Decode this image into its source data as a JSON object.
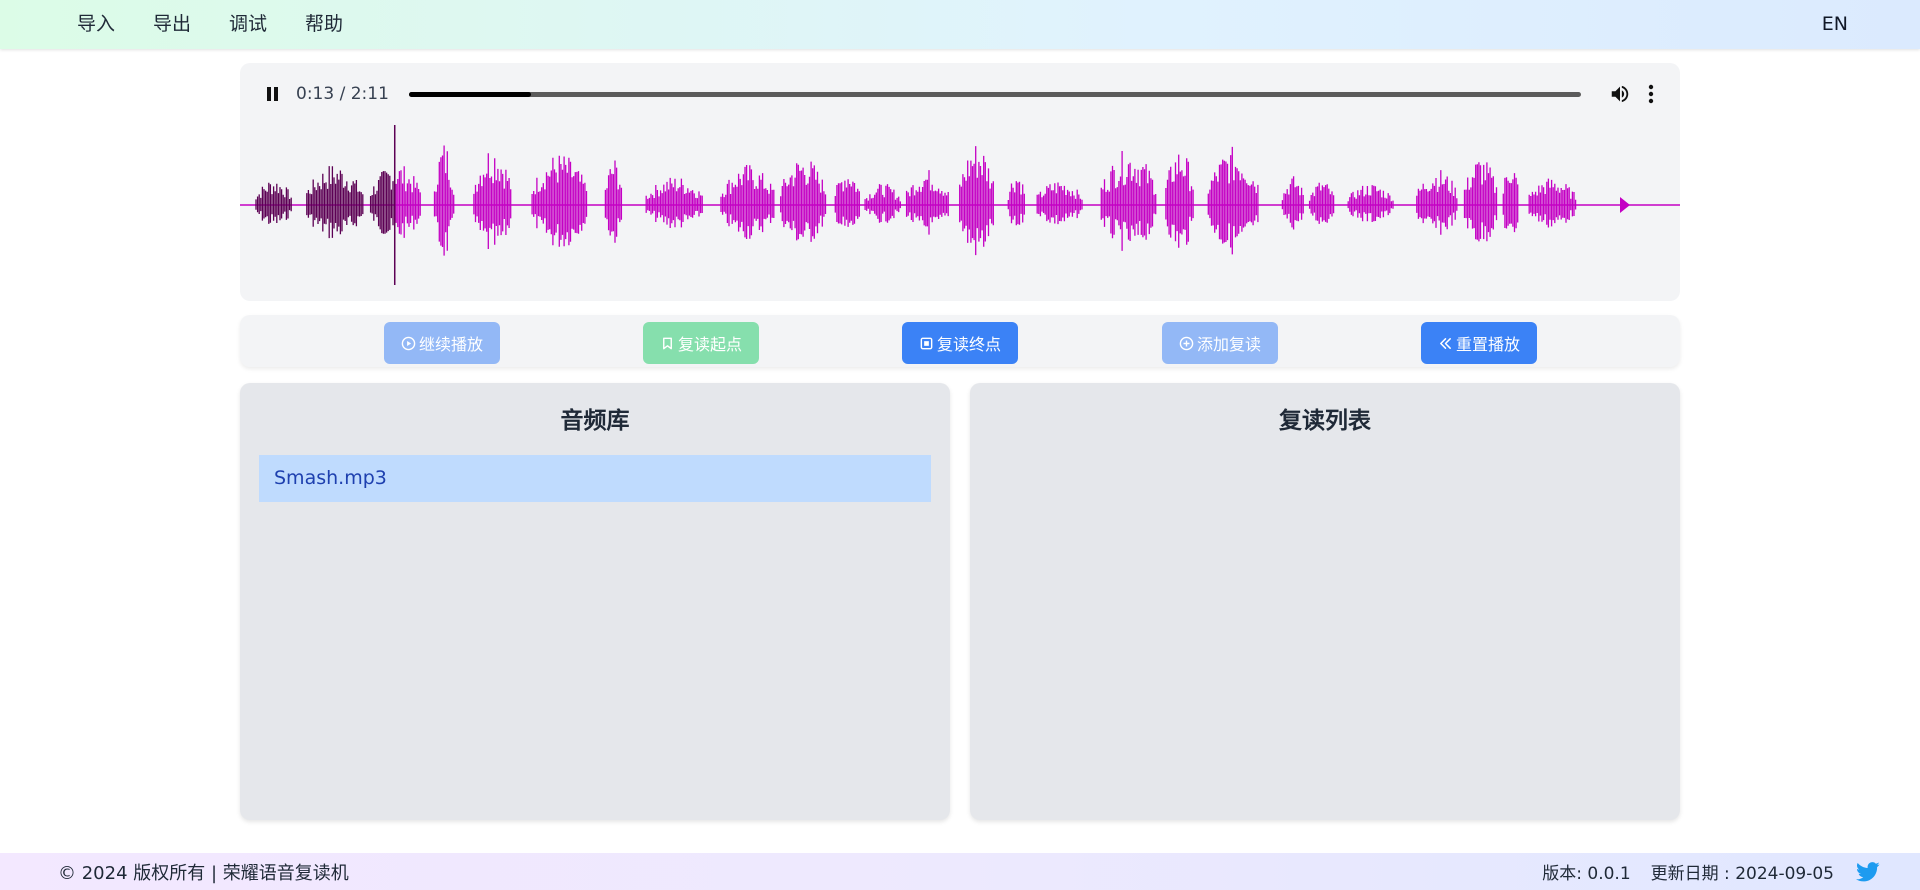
{
  "nav": {
    "menu": [
      {
        "label": "导入"
      },
      {
        "label": "导出"
      },
      {
        "label": "调试"
      },
      {
        "label": "帮助"
      }
    ],
    "language": "EN"
  },
  "player": {
    "current_time": "0:13",
    "duration": "2:11",
    "time_display": "0:13 / 2:11",
    "progress_fraction": 0.104,
    "played_fraction": 0.104,
    "icons": {
      "play_state": "pause-icon",
      "volume": "volume-icon",
      "more": "more-vertical-icon"
    },
    "waveform_colors": {
      "played": "#5c0054",
      "unplayed": "#c400c4"
    }
  },
  "controls": [
    {
      "label": "继续播放",
      "icon": "play-circle-icon",
      "color": "#93b8f6"
    },
    {
      "label": "复读起点",
      "icon": "bookmark-icon",
      "color": "#86dfad"
    },
    {
      "label": "复读终点",
      "icon": "stop-square-icon",
      "color": "#3b82f6"
    },
    {
      "label": "添加复读",
      "icon": "plus-circle-icon",
      "color": "#93b8f6"
    },
    {
      "label": "重置播放",
      "icon": "chevrons-left-icon",
      "color": "#3b82f6"
    }
  ],
  "library": {
    "title": "音频库",
    "files": [
      {
        "name": "Smash.mp3",
        "selected": true
      }
    ]
  },
  "repeat_list": {
    "title": "复读列表",
    "items": []
  },
  "footer": {
    "copyright": "© 2024 版权所有 | 荣耀语音复读机",
    "version": "版本: 0.0.1",
    "update_date": "更新日期 : 2024-09-05",
    "social_icon": "twitter-icon"
  }
}
